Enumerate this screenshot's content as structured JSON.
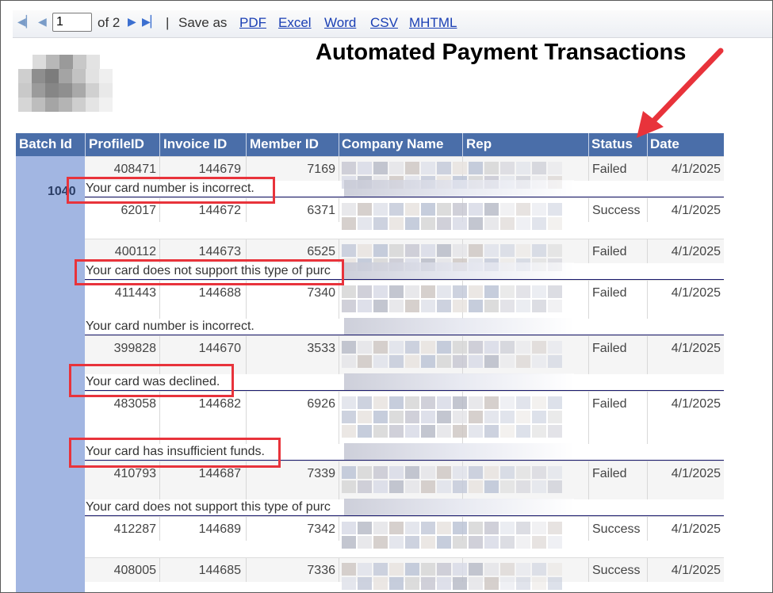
{
  "toolbar": {
    "page_value": "1",
    "of_pages": "of 2",
    "separator": "|",
    "save_as": "Save as",
    "exports": [
      "PDF",
      "Excel",
      "Word",
      "CSV",
      "MHTML"
    ]
  },
  "report": {
    "title": "Automated Payment Transactions"
  },
  "table": {
    "columns": [
      "Batch Id",
      "ProfileID",
      "Invoice ID",
      "Member ID",
      "Company Name",
      "Rep",
      "Status",
      "Date"
    ],
    "batch_id": "1040",
    "rows": [
      {
        "profile": "408471",
        "invoice": "144679",
        "member": "7169",
        "status": "Failed",
        "date": "4/1/2025",
        "message": "Your card number is incorrect."
      },
      {
        "profile": "62017",
        "invoice": "144672",
        "member": "6371",
        "status": "Success",
        "date": "4/1/2025",
        "message": ""
      },
      {
        "profile": "400112",
        "invoice": "144673",
        "member": "6525",
        "status": "Failed",
        "date": "4/1/2025",
        "message": "Your card does not support this type of purc"
      },
      {
        "profile": "411443",
        "invoice": "144688",
        "member": "7340",
        "status": "Failed",
        "date": "4/1/2025",
        "message": "Your card number is incorrect."
      },
      {
        "profile": "399828",
        "invoice": "144670",
        "member": "3533",
        "status": "Failed",
        "date": "4/1/2025",
        "message": "Your card was declined."
      },
      {
        "profile": "483058",
        "invoice": "144682",
        "member": "6926",
        "status": "Failed",
        "date": "4/1/2025",
        "message": "Your card has insufficient funds."
      },
      {
        "profile": "410793",
        "invoice": "144687",
        "member": "7339",
        "status": "Failed",
        "date": "4/1/2025",
        "message": "Your card does not support this type of purc"
      },
      {
        "profile": "412287",
        "invoice": "144689",
        "member": "7342",
        "status": "Success",
        "date": "4/1/2025",
        "message": ""
      },
      {
        "profile": "408005",
        "invoice": "144685",
        "member": "7336",
        "status": "Success",
        "date": "4/1/2025",
        "message": ""
      }
    ]
  },
  "colors": {
    "header_bg": "#4a6ea9",
    "batch_bg": "#a2b6e2",
    "highlight": "#e8333b",
    "link": "#1a3fb4"
  },
  "icons": [
    "first-page-icon",
    "prev-page-icon",
    "next-page-icon",
    "last-page-icon",
    "annotation-arrow-icon"
  ]
}
